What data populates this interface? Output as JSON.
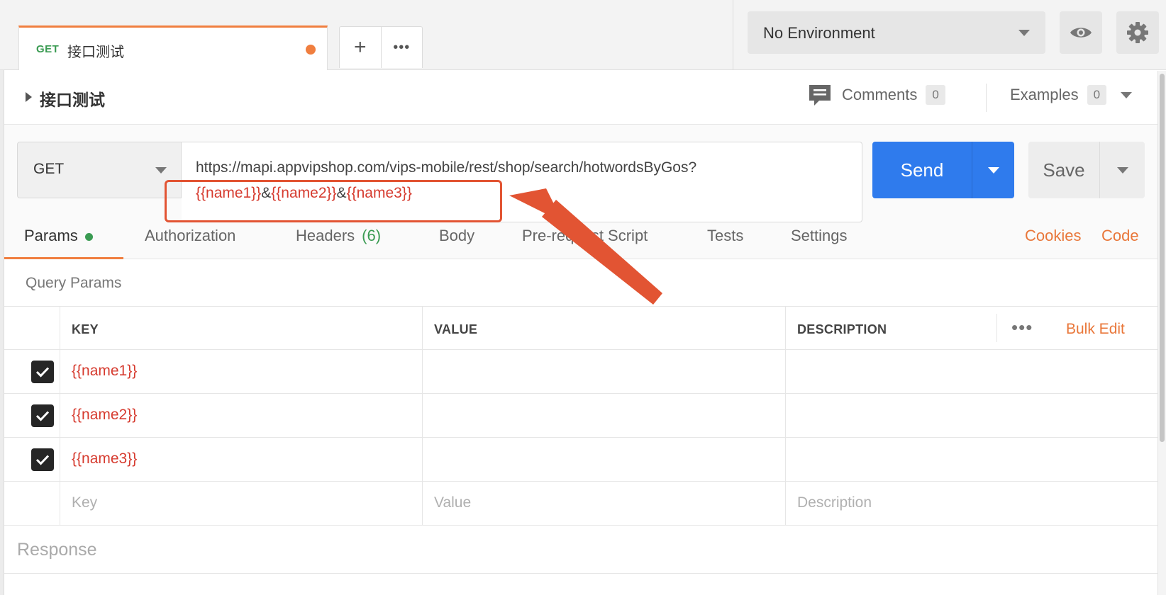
{
  "tab": {
    "method": "GET",
    "name": "接口测试"
  },
  "tab_actions": {
    "add": "+",
    "more": "•••"
  },
  "environment": {
    "selected": "No Environment"
  },
  "request": {
    "title": "接口测试",
    "comments_label": "Comments",
    "comments_count": "0",
    "examples_label": "Examples",
    "examples_count": "0",
    "method": "GET",
    "url_base": "https://mapi.appvipshop.com/vips-mobile/rest/shop/search/hotwordsByGos?",
    "url_vars": [
      "{{name1}}",
      "{{name2}}",
      "{{name3}}"
    ],
    "url_sep": "&",
    "send_label": "Send",
    "save_label": "Save"
  },
  "subtabs": {
    "params": "Params",
    "authorization": "Authorization",
    "headers": "Headers",
    "headers_count": "(6)",
    "body": "Body",
    "prerequest": "Pre-request Script",
    "tests": "Tests",
    "settings": "Settings",
    "cookies": "Cookies",
    "code": "Code"
  },
  "query_params": {
    "title": "Query Params",
    "headers": {
      "key": "KEY",
      "value": "VALUE",
      "description": "DESCRIPTION",
      "more": "•••",
      "bulk_edit": "Bulk Edit"
    },
    "rows": [
      {
        "key": "{{name1}}",
        "value": "",
        "description": "",
        "checked": true
      },
      {
        "key": "{{name2}}",
        "value": "",
        "description": "",
        "checked": true
      },
      {
        "key": "{{name3}}",
        "value": "",
        "description": "",
        "checked": true
      }
    ],
    "placeholders": {
      "key": "Key",
      "value": "Value",
      "description": "Description"
    }
  },
  "response": {
    "label": "Response"
  },
  "colors": {
    "accent_orange": "#f07e3f",
    "send_blue": "#2f7bed",
    "variable_red": "#d63b2f",
    "method_green": "#3a9b52",
    "annotation_red": "#e25433"
  }
}
